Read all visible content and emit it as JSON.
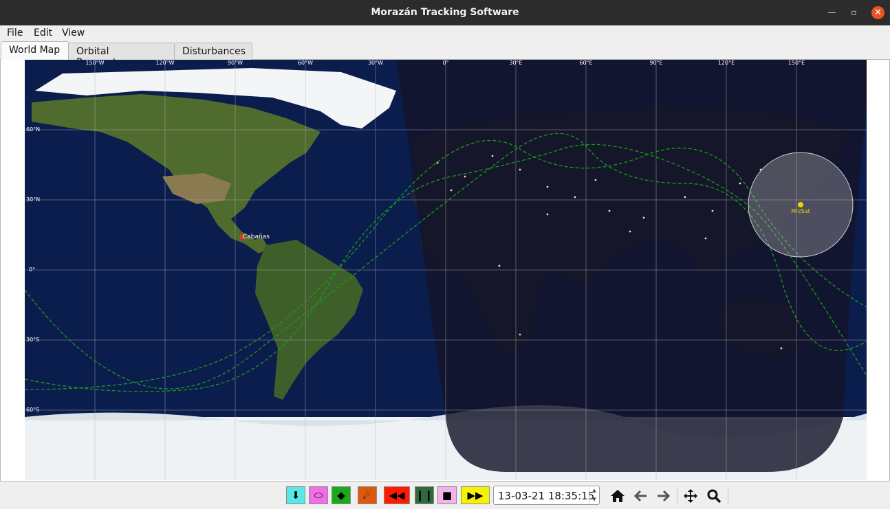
{
  "window": {
    "title": "Morazán Tracking Software",
    "min_glyph": "—",
    "max_glyph": "▫",
    "close_glyph": "✕"
  },
  "menu": {
    "file": "File",
    "edit": "Edit",
    "view": "View"
  },
  "tabs": [
    {
      "label": "World Map",
      "active": true
    },
    {
      "label": "Orbital Parameters",
      "active": false
    },
    {
      "label": "Disturbances",
      "active": false
    }
  ],
  "map": {
    "lon_labels": [
      "150°W",
      "120°W",
      "90°W",
      "60°W",
      "30°W",
      "0°",
      "30°E",
      "60°E",
      "90°E",
      "120°E",
      "150°E"
    ],
    "lat_labels": [
      "60°N",
      "30°N",
      "0°",
      "30°S",
      "60°S"
    ],
    "ground_station": {
      "name": "Cabañas",
      "color": "#ff2a2a"
    },
    "satellite": {
      "name": "MrzSat",
      "color": "#e6d600"
    },
    "colors": {
      "ocean": "#0b1d4d",
      "land": "#4f6b2e",
      "ice": "#f1f4f6",
      "night": "#141428",
      "orbit": "#1e9a1e",
      "grid": "#b4b4b4"
    }
  },
  "toolbar": {
    "buttons": [
      {
        "name": "download-button",
        "icon": "download-arrow-icon",
        "glyph": "⬇",
        "bg": "#59e7e7"
      },
      {
        "name": "ellipse-button",
        "icon": "ellipse-icon",
        "glyph": "⬭",
        "bg": "#f06ee8"
      },
      {
        "name": "satellite-button",
        "icon": "satellite-icon",
        "glyph": "◆",
        "bg": "#1ca81c"
      },
      {
        "name": "comet-button",
        "icon": "comet-icon",
        "glyph": "☄",
        "bg": "#dd5a0c"
      },
      {
        "name": "rewind-button",
        "icon": "rewind-icon",
        "glyph": "◀◀",
        "bg": "#ff1a00"
      },
      {
        "name": "pause-button",
        "icon": "pause-icon",
        "glyph": "❙❙",
        "bg": "#2f6a3e"
      },
      {
        "name": "stop-button",
        "icon": "stop-icon",
        "glyph": "■",
        "bg": "#f4b3e8"
      },
      {
        "name": "fast-forward-button",
        "icon": "fast-forward-icon",
        "glyph": "▶▶",
        "bg": "#f6f200"
      }
    ],
    "datetime": "13-03-21 18:35:15",
    "spin_up": "▲",
    "spin_down": "▼"
  }
}
